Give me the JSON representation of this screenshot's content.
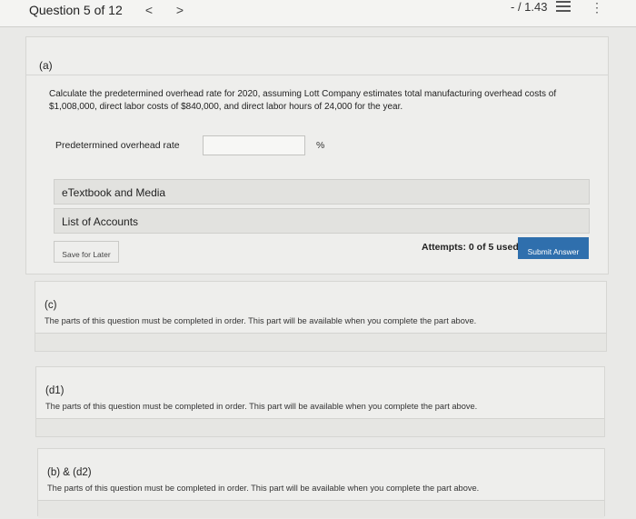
{
  "header": {
    "question_counter": "Question 5 of 12",
    "prev_icon": "chevron-left-icon",
    "next_icon": "chevron-right-icon",
    "score": "- / 1.43",
    "prev_glyph": "<",
    "next_glyph": ">",
    "more_glyph": "⋮"
  },
  "part_a": {
    "label": "(a)",
    "question": "Calculate the predetermined overhead rate for 2020, assuming Lott Company estimates total manufacturing overhead costs of $1,008,000, direct labor costs of $840,000, and direct labor hours of 24,000 for the year.",
    "field_label": "Predetermined overhead rate",
    "field_value": "",
    "unit": "%",
    "resources": [
      "eTextbook and Media",
      "List of Accounts"
    ],
    "save_label": "Save for Later",
    "attempts": "Attempts: 0 of 5 used",
    "submit_label": "Submit Answer"
  },
  "locked_parts": [
    {
      "label": "(c)",
      "note": "The parts of this question must be completed in order. This part will be available when you complete the part above."
    },
    {
      "label": "(d1)",
      "note": "The parts of this question must be completed in order. This part will be available when you complete the part above."
    },
    {
      "label": "(b) & (d2)",
      "note": "The parts of this question must be completed in order. This part will be available when you complete the part above."
    }
  ],
  "colors": {
    "background": "#e9e9e7",
    "panel": "#eeeeec",
    "submit_button": "#2f6fad"
  }
}
